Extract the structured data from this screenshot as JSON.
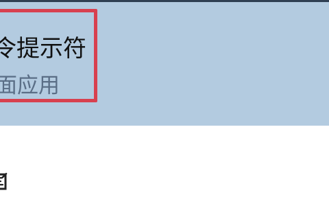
{
  "search_result": {
    "title": "令提示符",
    "subtitle": "面应用"
  },
  "colors": {
    "selected_background": "#b3cbe0",
    "highlight_border": "#d8404f",
    "top_bar": "#2f3f52"
  },
  "icons": {
    "partial_icon": "app-icon"
  }
}
